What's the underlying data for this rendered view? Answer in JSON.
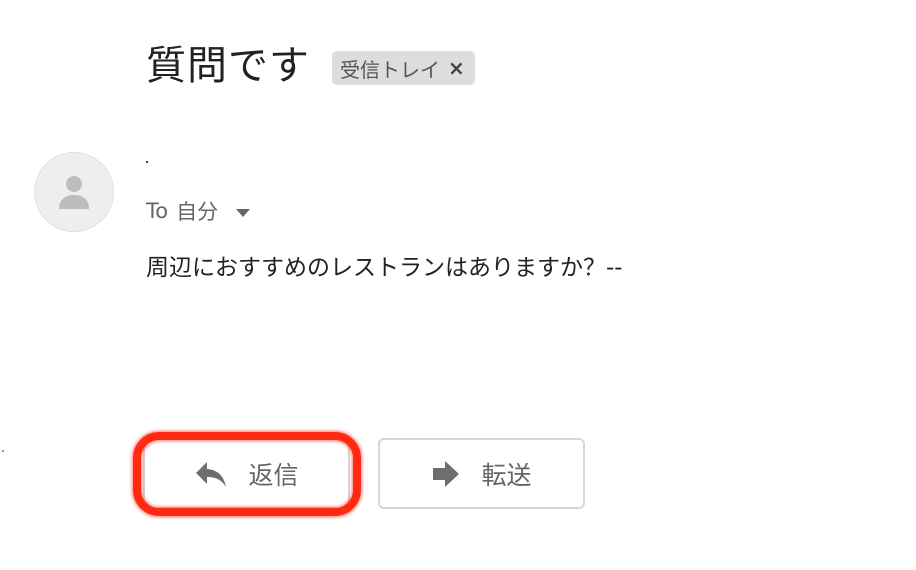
{
  "email": {
    "subject": "質問です",
    "label": {
      "text": "受信トレイ",
      "close_symbol": "×"
    },
    "avatar_icon": "person-icon",
    "recipient": {
      "prefix": "To",
      "name": "自分"
    },
    "body": "周辺におすすめのレストランはありますか？--"
  },
  "actions": {
    "reply": {
      "label": "返信",
      "icon": "reply-arrow-icon"
    },
    "forward": {
      "label": "転送",
      "icon": "forward-arrow-icon"
    }
  },
  "colors": {
    "highlight": "#ff2a14",
    "chip_background": "#dddddd",
    "button_border": "#d6d6d6",
    "secondary_text": "#666666"
  }
}
